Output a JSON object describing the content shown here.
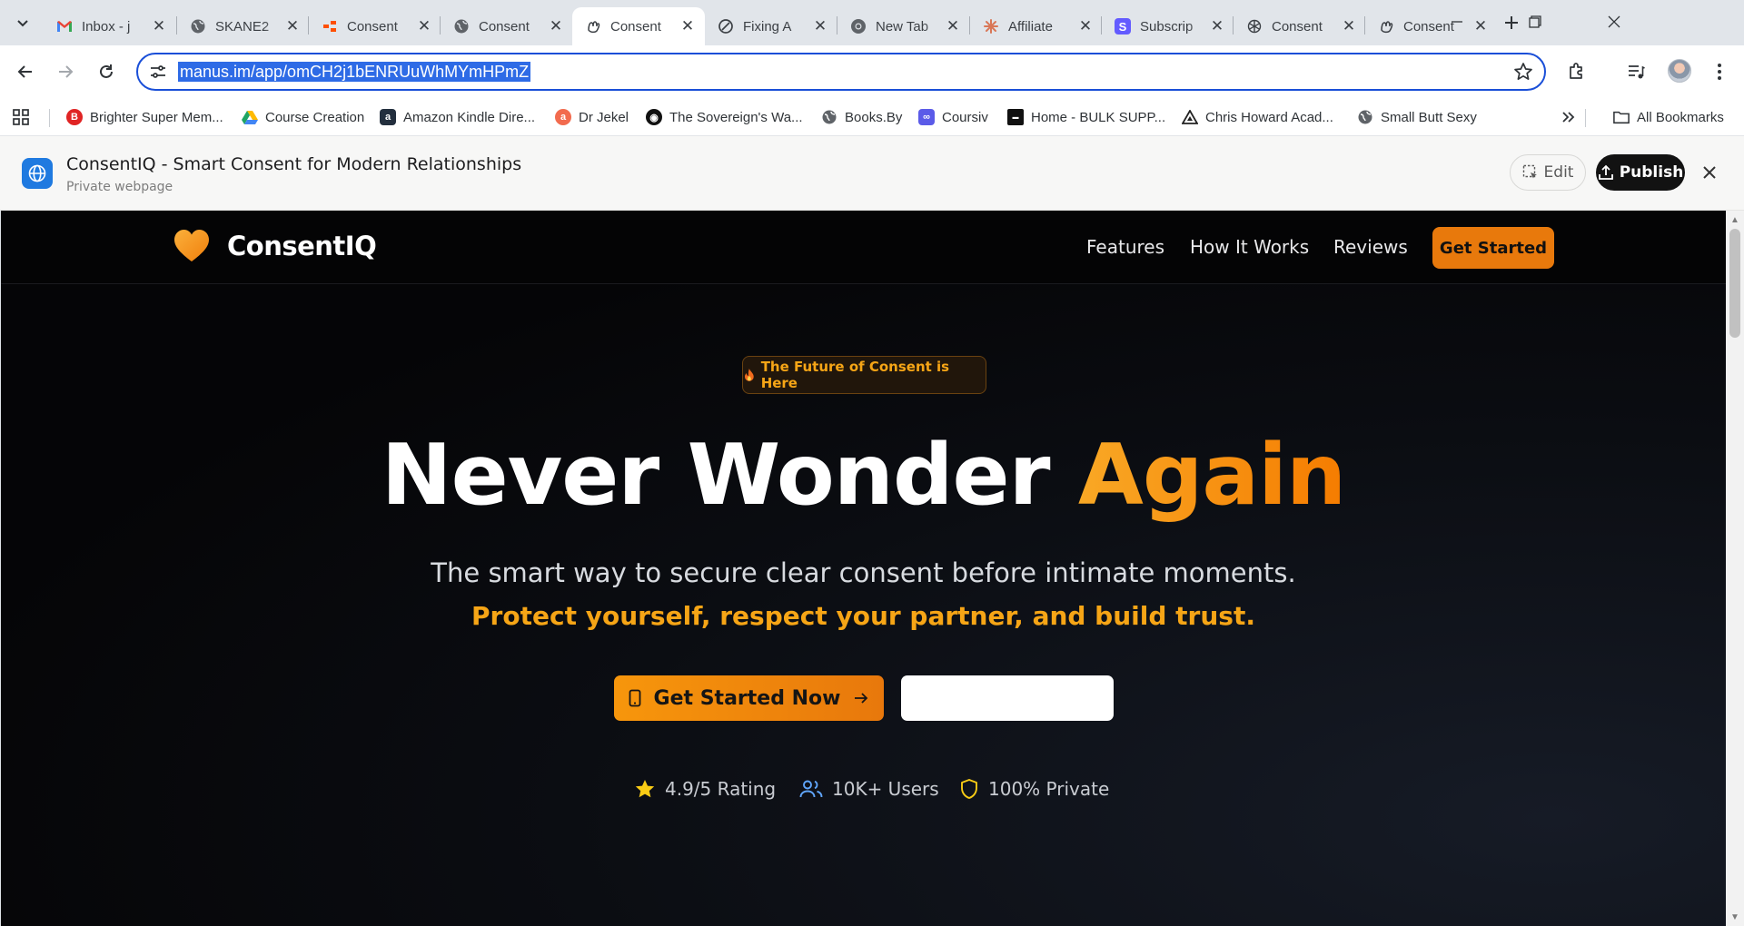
{
  "browser": {
    "tabs": [
      {
        "title": "Inbox - j",
        "icon": "gmail-icon"
      },
      {
        "title": "SKANE2",
        "icon": "globe-icon"
      },
      {
        "title": "Consent",
        "icon": "zapier-icon"
      },
      {
        "title": "Consent",
        "icon": "globe-icon"
      },
      {
        "title": "Consent",
        "icon": "manus-icon",
        "active": true
      },
      {
        "title": "Fixing A",
        "icon": "perplexity-icon"
      },
      {
        "title": "New Tab",
        "icon": "chrome-icon"
      },
      {
        "title": "Affiliate",
        "icon": "claude-icon"
      },
      {
        "title": "Subscrip",
        "icon": "stripe-icon"
      },
      {
        "title": "Consent",
        "icon": "chatgpt-icon"
      },
      {
        "title": "Consent",
        "icon": "manus-icon"
      }
    ],
    "url": "manus.im/app/omCH2j1bENRUuWhMYmHPmZ",
    "bookmarks": [
      {
        "label": "Brighter Super Mem...",
        "icon": "brighter-icon",
        "color": "#e02424"
      },
      {
        "label": "Course Creation",
        "icon": "google-drive-icon",
        "color": "#1fa463"
      },
      {
        "label": "Amazon Kindle Dire...",
        "icon": "amazon-icon",
        "color": "#232f3e"
      },
      {
        "label": "Dr Jekel",
        "icon": "dr-jekel-icon",
        "color": "#f26b4e"
      },
      {
        "label": "The Sovereign's Wa...",
        "icon": "sovereign-icon",
        "color": "#111111"
      },
      {
        "label": "Books.By",
        "icon": "globe-icon",
        "color": "#5f6368"
      },
      {
        "label": "Coursiv",
        "icon": "coursiv-icon",
        "color": "#5b5be8"
      },
      {
        "label": "Home - BULK SUPP...",
        "icon": "bulk-icon",
        "color": "#111111"
      },
      {
        "label": "Chris Howard Acad...",
        "icon": "triangle-icon",
        "color": "#222222"
      },
      {
        "label": "Small Butt Sexy",
        "icon": "globe-icon",
        "color": "#5f6368"
      }
    ],
    "all_bookmarks": "All Bookmarks"
  },
  "preview": {
    "title": "ConsentIQ - Smart Consent for Modern Relationships",
    "subtitle": "Private webpage",
    "edit_label": "Edit",
    "publish_label": "Publish"
  },
  "site": {
    "logo": "ConsentIQ",
    "nav": {
      "features": "Features",
      "how_it_works": "How It Works",
      "reviews": "Reviews",
      "cta": "Get Started"
    },
    "badge": "The Future of Consent is Here",
    "headline_main": "Never Wonder ",
    "headline_accent": "Again",
    "subline": "The smart way to secure clear consent before intimate moments.",
    "tagline": "Protect yourself, respect your partner, and build trust.",
    "cta_primary": "Get Started Now",
    "cta_secondary": "",
    "stats": {
      "rating": "4.9/5 Rating",
      "users": "10K+ Users",
      "private": "100% Private"
    }
  },
  "colors": {
    "accent": "#f6a516",
    "accent_dark": "#e8790c",
    "url_highlight": "#2e6be6"
  }
}
